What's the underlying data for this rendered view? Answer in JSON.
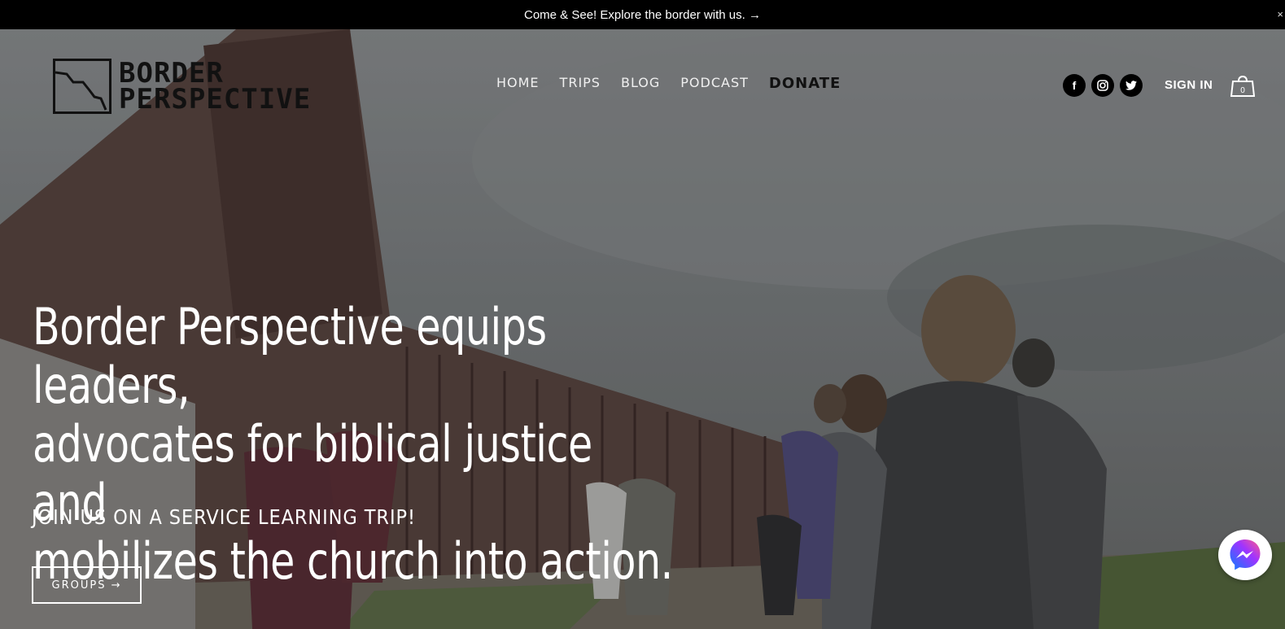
{
  "announcement": {
    "text": "Come & See! Explore the border with us. →",
    "close": "×"
  },
  "logo": {
    "line1": "BORDER",
    "line2": "PERSPECTIVE"
  },
  "nav": {
    "items": [
      "HOME",
      "TRIPS",
      "BLOG",
      "PODCAST",
      "DONATE"
    ]
  },
  "social": {
    "facebook": "f",
    "instagram": "◎",
    "twitter": "🐦"
  },
  "header": {
    "signin": "SIGN IN",
    "cart_count": "0"
  },
  "hero": {
    "headline_1": "Border Perspective equips leaders,",
    "headline_2": "advocates for biblical justice and",
    "headline_3": "mobilizes the church into action.",
    "subhead": "JOIN US ON A SERVICE LEARNING TRIP!",
    "cta": "GROUPS →"
  },
  "colors": {
    "announce_bg": "#000000",
    "messenger": "#1877f2"
  }
}
